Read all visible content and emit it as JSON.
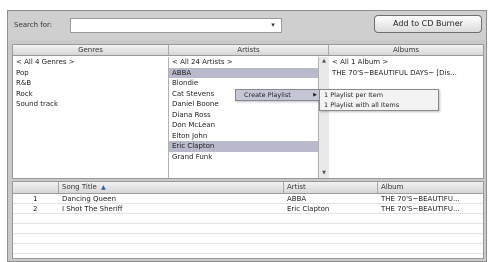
{
  "search": {
    "label": "Search for:",
    "value": ""
  },
  "burn_button": "Add to CD Burner",
  "columns": {
    "genres": {
      "header": "Genres",
      "items": [
        "< All 4 Genres >",
        "Pop",
        "R&B",
        "Rock",
        "Sound track"
      ],
      "selected": ""
    },
    "artists": {
      "header": "Artists",
      "items": [
        "< All 24 Artists >",
        "ABBA",
        "Blondie",
        "Cat Stevens",
        "Daniel Boone",
        "Diana Ross",
        "Don McLean",
        "Elton John",
        "Eric Clapton",
        "Grand Funk"
      ],
      "selected": [
        "ABBA",
        "Eric Clapton"
      ]
    },
    "albums": {
      "header": "Albums",
      "items": [
        "< All 1 Album >",
        "THE 70'S~BEAUTIFUL DAYS~ [Dis..."
      ]
    }
  },
  "context_menu": {
    "item": "Create Playlist",
    "arrow": "▶",
    "submenu": [
      "Playlist per Item",
      "Playlist with all Items"
    ],
    "submenu_prefix": "1"
  },
  "songs": {
    "headers": {
      "num": "",
      "title": "Song Title",
      "sort_arrow": "▲",
      "artist": "Artist",
      "album": "Album"
    },
    "rows": [
      {
        "num": "1",
        "title": "Dancing Queen",
        "artist": "ABBA",
        "album": "THE 70'S~BEAUTIFU..."
      },
      {
        "num": "2",
        "title": "I Shot The Sheriff",
        "artist": "Eric Clapton",
        "album": "THE 70'S~BEAUTIFU..."
      }
    ]
  },
  "colors": {
    "selection": "#b8b9cb",
    "menu_highlight": "#c4c6d6",
    "window_bg": "#c9c9c9"
  }
}
